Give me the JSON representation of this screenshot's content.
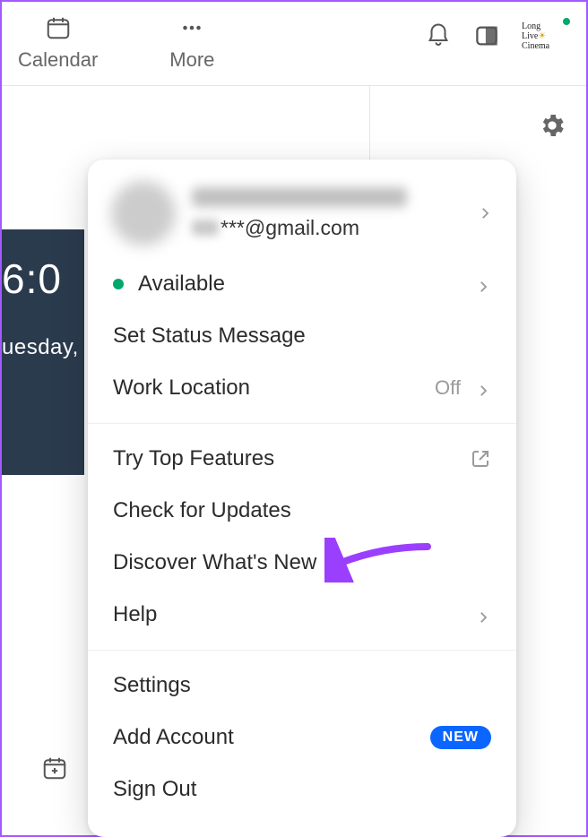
{
  "toolbar": {
    "calendar_label": "Calendar",
    "more_label": "More"
  },
  "avatar_text": "Long\nLive\nCinema",
  "background": {
    "time": "6:0",
    "day": "uesday,"
  },
  "menu": {
    "profile": {
      "email_masked": "***@gmail.com"
    },
    "status": {
      "label": "Available"
    },
    "set_status": "Set Status Message",
    "work_location": {
      "label": "Work Location",
      "value": "Off"
    },
    "try_features": "Try Top Features",
    "check_updates": "Check for Updates",
    "discover": "Discover What's New",
    "help": "Help",
    "settings": "Settings",
    "add_account": {
      "label": "Add Account",
      "badge": "NEW"
    },
    "sign_out": "Sign Out"
  }
}
